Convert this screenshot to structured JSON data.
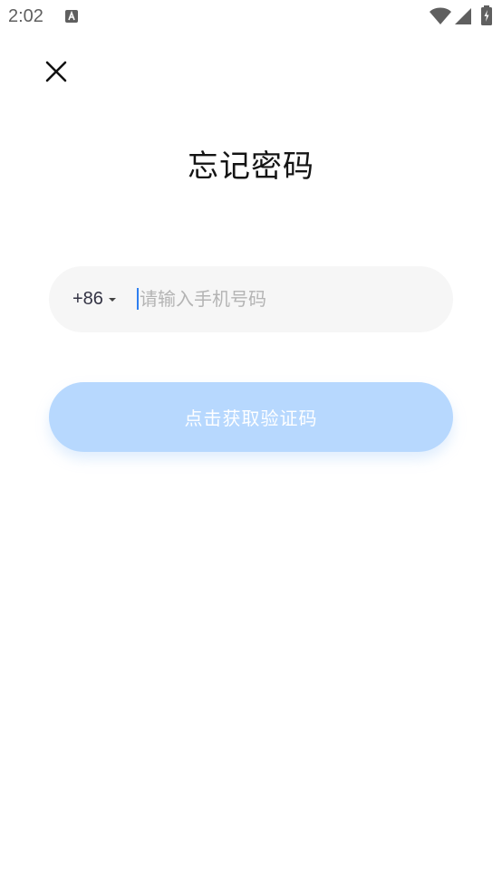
{
  "status_bar": {
    "time": "2:02",
    "notification_icon": "accessibility-a-icon",
    "wifi_icon": "wifi-icon",
    "cell_icon": "cell-signal-icon",
    "battery_icon": "battery-charging-icon"
  },
  "header": {
    "close_icon": "close-icon",
    "title": "忘记密码"
  },
  "form": {
    "country_code": "+86",
    "phone_placeholder": "请输入手机号码",
    "phone_value": "",
    "submit_label": "点击获取验证码"
  },
  "colors": {
    "accent": "#2f7ff0",
    "button_disabled": "#b7d8fe",
    "input_bg": "#f6f6f6",
    "placeholder": "#b4b4b4"
  }
}
